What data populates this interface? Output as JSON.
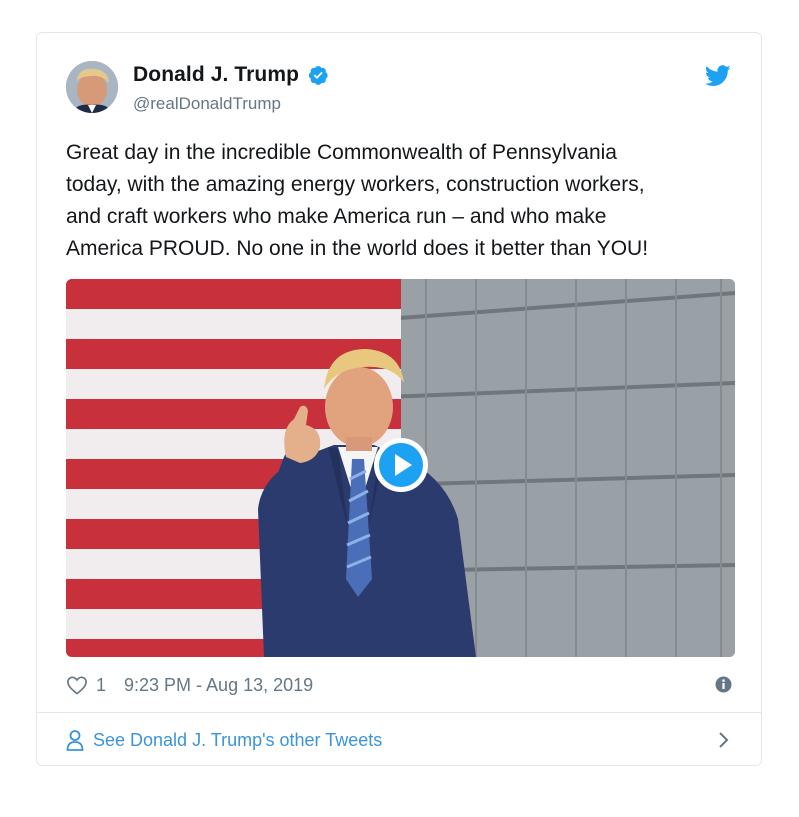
{
  "author": {
    "display_name": "Donald J. Trump",
    "handle": "@realDonaldTrump",
    "verified": true
  },
  "tweet": {
    "text_lines": [
      "Great day in the incredible Commonwealth of Pennsylvania",
      "today, with the amazing energy workers, construction workers,",
      "and craft workers who make America run – and who make",
      "America PROUD. No one in the world does it better than YOU!"
    ],
    "like_count": "1",
    "timestamp": "9:23 PM - Aug 13, 2019"
  },
  "more_tweets": {
    "label": "See Donald J. Trump's other Tweets"
  },
  "icons": {
    "brand": "twitter-bird-icon",
    "verified": "verified-badge-icon",
    "like": "heart-icon",
    "info": "info-icon",
    "profile": "person-icon",
    "next": "chevron-right-icon",
    "play": "play-icon"
  },
  "colors": {
    "brand_blue": "#1da1f2",
    "link_blue": "#3b94d9",
    "text": "#14171a",
    "secondary_text": "#657786",
    "border": "#e1e8ed"
  }
}
